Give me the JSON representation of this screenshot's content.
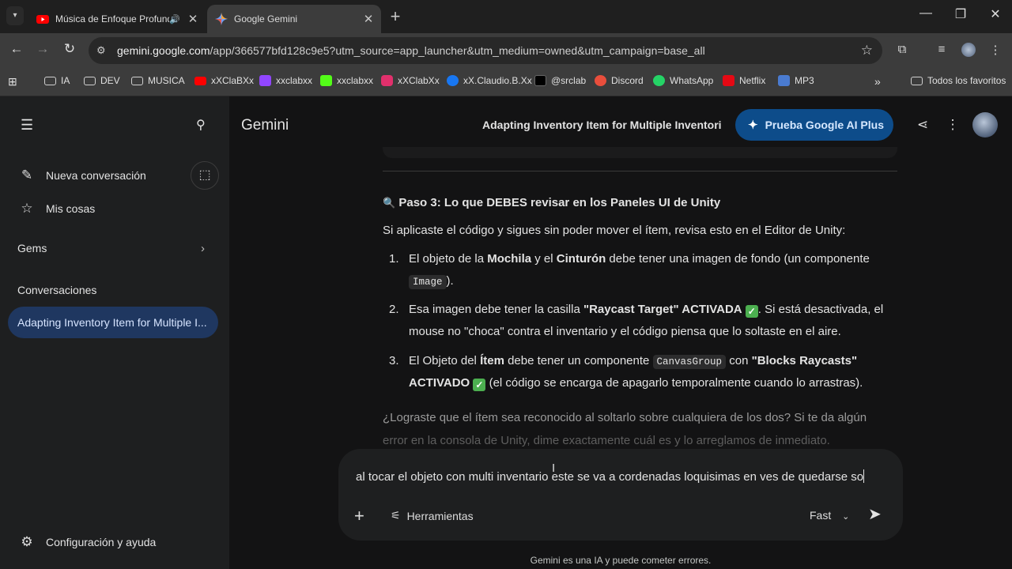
{
  "browser": {
    "tabs": [
      {
        "title": "Música de Enfoque Profundo",
        "active": false,
        "favicon": "youtube-icon",
        "audio": true
      },
      {
        "title": "Google Gemini",
        "active": true,
        "favicon": "gemini-icon"
      }
    ],
    "url_host": "gemini.google.com",
    "url_rest": "/app/366577bfd128c9e5?utm_source=app_launcher&utm_medium=owned&utm_campaign=base_all",
    "bookmarks": [
      {
        "label": "IA",
        "icon": "folder-icon"
      },
      {
        "label": "DEV",
        "icon": "folder-icon"
      },
      {
        "label": "MUSICA",
        "icon": "folder-icon"
      },
      {
        "label": "xXClaBXx",
        "icon": "youtube-icon",
        "color": "#ff0000"
      },
      {
        "label": "xxclabxx",
        "icon": "twitch-icon",
        "color": "#9146ff"
      },
      {
        "label": "xxclabxx",
        "icon": "kick-icon",
        "color": "#53fc18"
      },
      {
        "label": "xXClabXx",
        "icon": "instagram-icon",
        "color": "#e1306c"
      },
      {
        "label": "xX.Claudio.B.Xx",
        "icon": "facebook-icon",
        "color": "#1877f2"
      },
      {
        "label": "@srclab",
        "icon": "tiktok-icon",
        "color": "#000000"
      },
      {
        "label": "Discord",
        "icon": "discord-icon",
        "color": "#e94e3c"
      },
      {
        "label": "WhatsApp",
        "icon": "whatsapp-icon",
        "color": "#25d366"
      },
      {
        "label": "Netflix",
        "icon": "netflix-icon",
        "color": "#e50914"
      },
      {
        "label": "MP3",
        "icon": "mp3-icon",
        "color": "#4a7bd0"
      }
    ],
    "all_bookmarks": "Todos los favoritos"
  },
  "sidebar": {
    "new_chat": "Nueva conversación",
    "my_stuff": "Mis cosas",
    "gems": "Gems",
    "conversations_header": "Conversaciones",
    "selected_conversation": "Adapting Inventory Item for Multiple I...",
    "settings": "Configuración y ayuda"
  },
  "header": {
    "brand": "Gemini",
    "conversation_title": "Adapting Inventory Item for Multiple Inventori",
    "upgrade_button": "Prueba Google AI Plus"
  },
  "response": {
    "heading_icon": "🔍",
    "heading": "Paso 3: Lo que DEBES revisar en los Paneles UI de Unity",
    "intro": "Si aplicaste el código y sigues sin poder mover el ítem, revisa esto en el Editor de Unity:",
    "item1": {
      "num": "1.",
      "a": "El objeto de la ",
      "b1": "Mochila",
      "c": " y el ",
      "b2": "Cinturón",
      "d": " debe tener una imagen de fondo (un componente",
      "code": "Image",
      "e": ")."
    },
    "item2": {
      "num": "2.",
      "a": "Esa imagen debe tener la casilla ",
      "b": "\"Raycast Target\" ACTIVADA",
      "c": ". Si está desactivada, el",
      "line2": "mouse no \"choca\" contra el inventario y el código piensa que lo soltaste en el aire."
    },
    "item3": {
      "num": "3.",
      "a": "El Objeto del ",
      "b": "Ítem",
      "c": " debe tener un componente ",
      "code": "CanvasGroup",
      "d": " con ",
      "e": "\"Blocks Raycasts\"",
      "f": "ACTIVADO",
      "g": " (el código se encarga de apagarlo temporalmente cuando lo arrastras)."
    },
    "closing1": "¿Lograste que el ítem sea reconocido al soltarlo sobre cualquiera de los dos? Si te da algún",
    "closing2": "error en la consola de Unity, dime exactamente cuál es y lo arreglamos de inmediato."
  },
  "composer": {
    "text": "al tocar el objeto con multi inventario este se va a cordenadas loquisimas en ves de quedarse so",
    "tools": "Herramientas",
    "model": "Fast"
  },
  "disclaimer": "Gemini es una IA y puede cometer errores."
}
